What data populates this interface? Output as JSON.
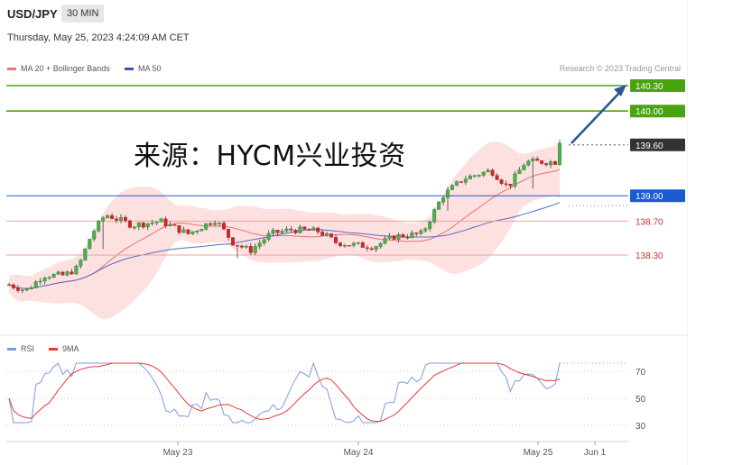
{
  "header": {
    "symbol": "USD/JPY",
    "timeframe": "30 MIN",
    "timestamp": "Thursday, May 25, 2023 4:24:09 AM CET"
  },
  "legend": {
    "bb": "MA 20 + Bollinger Bands",
    "ma50": "MA 50",
    "source": "Research © 2023 Trading Central"
  },
  "overlay": "来源：HYCM兴业投资",
  "rsi_legend": {
    "rsi": "RSI",
    "ma": "9MA"
  },
  "colors": {
    "up": "#4caf50",
    "down": "#c62828",
    "ma20": "#e57373",
    "ma50": "#5c6bc0",
    "band": "#fde0e0",
    "rsi": "#7b9be0",
    "rsi_ma": "#e53935",
    "green_level": "#4aa310",
    "blue_level": "#1a5bd1"
  },
  "chart_data": {
    "type": "candlestick",
    "price_labels": [
      {
        "value": 140.3,
        "label": "140.30",
        "style": "green"
      },
      {
        "value": 140.0,
        "label": "140.00",
        "style": "green"
      },
      {
        "value": 139.6,
        "label": "139.60",
        "style": "current"
      },
      {
        "value": 139.0,
        "label": "139.00",
        "style": "blue"
      },
      {
        "value": 138.7,
        "label": "138.70",
        "style": "red"
      },
      {
        "value": 138.3,
        "label": "138.30",
        "style": "red"
      }
    ],
    "x_ticks": [
      "May 23",
      "May 24",
      "May 25",
      "Jun 1"
    ],
    "rsi": {
      "ticks": [
        70,
        50,
        30
      ],
      "ylim": [
        20,
        80
      ]
    },
    "ylim": [
      137.7,
      140.45
    ]
  }
}
